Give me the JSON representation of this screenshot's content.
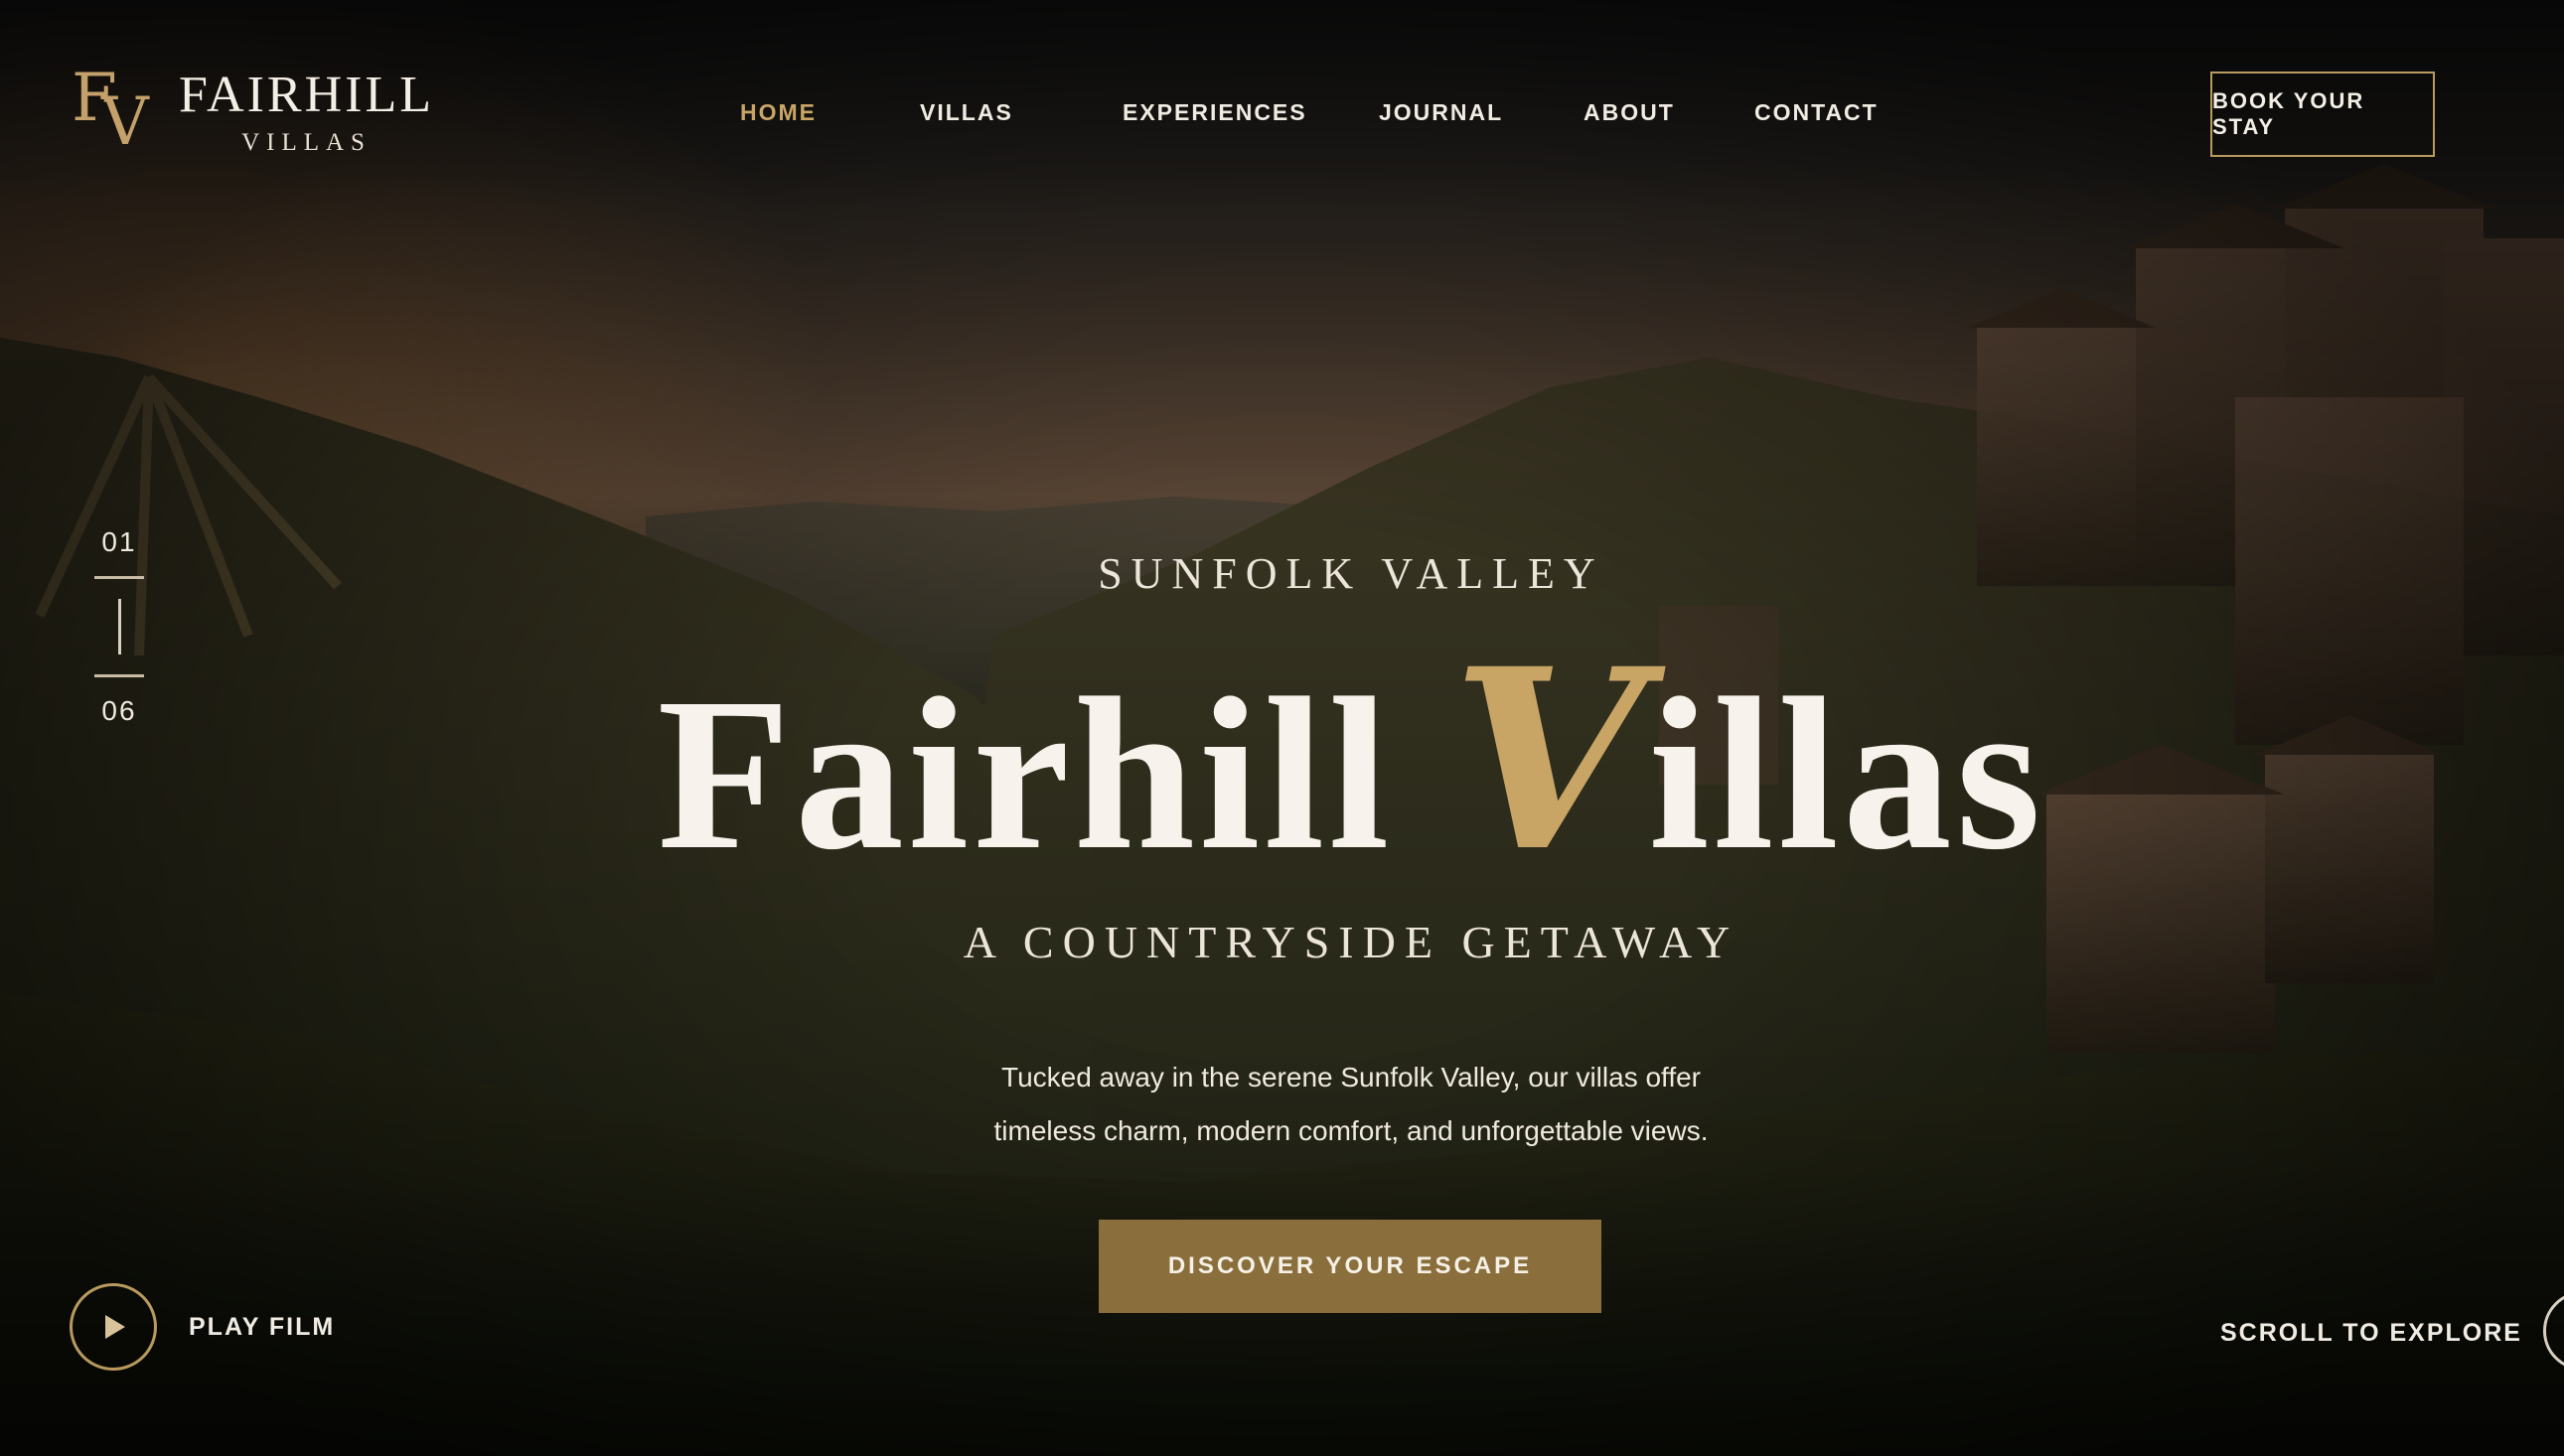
{
  "brand": {
    "mark_letter_1": "F",
    "mark_letter_2": "V",
    "name": "FAIRHILL",
    "sub": "VILLAS"
  },
  "nav": {
    "items": [
      {
        "label": "HOME",
        "active": true
      },
      {
        "label": "VILLAS",
        "active": false
      },
      {
        "label": "EXPERIENCES",
        "active": false
      },
      {
        "label": "JOURNAL",
        "active": false
      },
      {
        "label": "ABOUT",
        "active": false
      },
      {
        "label": "CONTACT",
        "active": false
      }
    ],
    "book_label": "BOOK YOUR STAY"
  },
  "slides": {
    "current": "01",
    "total": "06"
  },
  "hero": {
    "eyebrow": "SUNFOLK VALLEY",
    "title_part_1": "Fairhill ",
    "title_accent": "V",
    "title_part_2": "illas",
    "tagline": "A COUNTRYSIDE GETAWAY",
    "blurb_line_1": "Tucked away in the serene Sunfolk Valley, our villas offer",
    "blurb_line_2": "timeless charm, modern comfort, and unforgettable views.",
    "cta_label": "DISCOVER YOUR ESCAPE"
  },
  "footer": {
    "play_label": "PLAY FILM",
    "scroll_label": "SCROLL TO EXPLORE"
  },
  "colors": {
    "accent_gold": "#c9a565",
    "cta_bg": "#8a6f3c",
    "text_light": "#f2ede4"
  },
  "icons": {
    "play": "play-icon",
    "logo": "fv-monogram-icon"
  }
}
